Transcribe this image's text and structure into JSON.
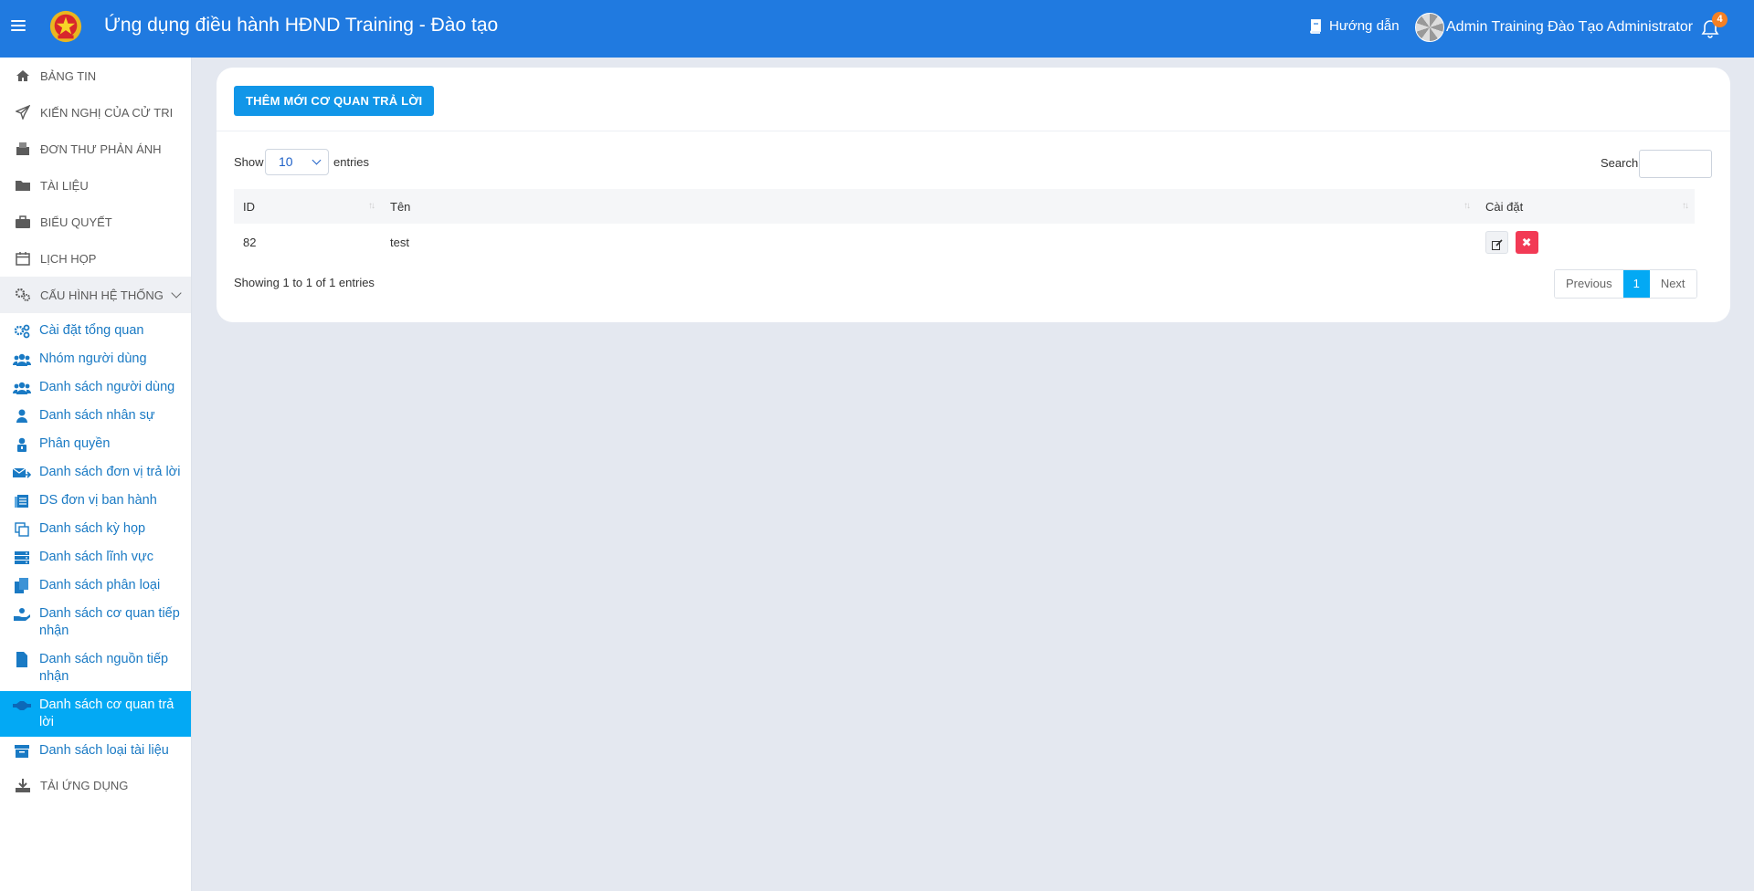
{
  "header": {
    "title": "Ứng dụng điều hành HĐND Training - Đào tạo",
    "guide_label": "Hướng dẫn",
    "user_name": "Admin Training Đào Tạo Administrator",
    "notification_count": "4"
  },
  "sidebar": {
    "main_items": [
      {
        "label": "BẢNG TIN",
        "icon": "home-icon"
      },
      {
        "label": "KIẾN NGHỊ CỦA CỬ TRI",
        "icon": "paper-plane-icon"
      },
      {
        "label": "ĐƠN THƯ PHẢN ÁNH",
        "icon": "inbox-icon"
      },
      {
        "label": "TÀI LIỆU",
        "icon": "folder-icon"
      },
      {
        "label": "BIỂU QUYẾT",
        "icon": "briefcase-icon"
      },
      {
        "label": "LỊCH HỌP",
        "icon": "calendar-icon"
      },
      {
        "label": "CẤU HÌNH HỆ THỐNG",
        "icon": "gears-icon"
      }
    ],
    "sub_items": [
      {
        "label": "Cài đặt tổng quan",
        "icon": "cogs-icon"
      },
      {
        "label": "Nhóm người dùng",
        "icon": "users-icon"
      },
      {
        "label": "Danh sách người dùng",
        "icon": "users-icon"
      },
      {
        "label": "Danh sách nhân sự",
        "icon": "user-icon"
      },
      {
        "label": "Phân quyền",
        "icon": "user-lock-icon"
      },
      {
        "label": "Danh sách đơn vị trả lời",
        "icon": "mail-forward-icon"
      },
      {
        "label": "DS đơn vị ban hành",
        "icon": "doc-list-icon"
      },
      {
        "label": "Danh sách kỳ họp",
        "icon": "copy-icon"
      },
      {
        "label": "Danh sách lĩnh vực",
        "icon": "server-icon"
      },
      {
        "label": "Danh sách phân loại",
        "icon": "files-icon"
      },
      {
        "label": "Danh sách cơ quan tiếp nhận",
        "icon": "hand-holding-icon"
      },
      {
        "label": "Danh sách nguồn tiếp nhận",
        "icon": "file-icon"
      },
      {
        "label": "Danh sách cơ quan trả lời",
        "icon": "handshake-icon"
      },
      {
        "label": "Danh sách loại tài liệu",
        "icon": "archive-icon"
      }
    ],
    "bottom_item": {
      "label": "TẢI ỨNG DỤNG",
      "icon": "download-icon"
    }
  },
  "main": {
    "add_button_label": "THÊM MỚI CƠ QUAN TRẢ LỜI",
    "show_label": "Show",
    "page_length": "10",
    "entries_label": "entries",
    "search_label": "Search:",
    "columns": [
      "ID",
      "Tên",
      "Cài đặt"
    ],
    "rows": [
      {
        "id": "82",
        "name": "test"
      }
    ],
    "info": "Showing 1 to 1 of 1 entries",
    "pagination": {
      "previous": "Previous",
      "current": "1",
      "next": "Next"
    }
  }
}
